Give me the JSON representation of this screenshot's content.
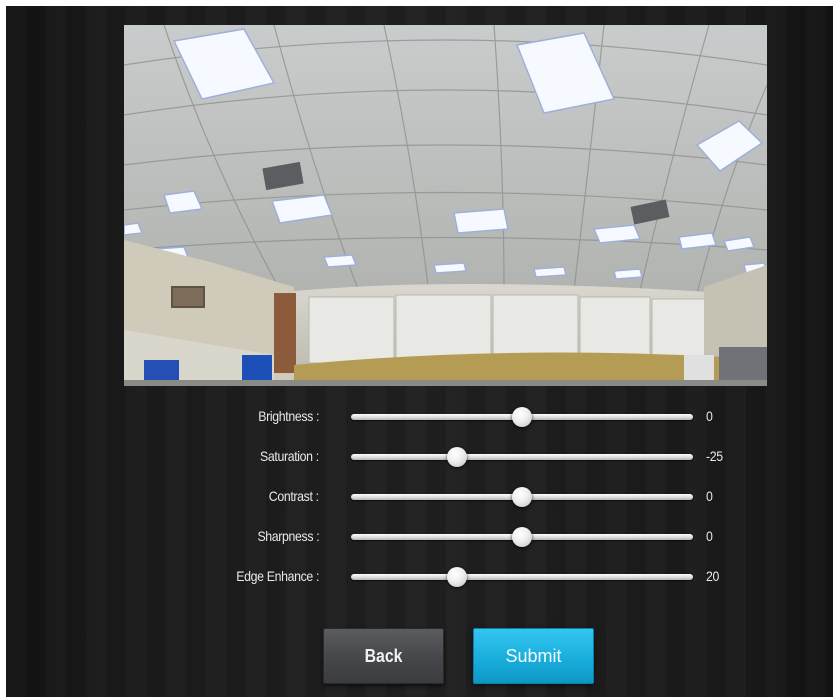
{
  "controls": [
    {
      "label": "Brightness :",
      "value": "0",
      "level": 0.5
    },
    {
      "label": "Saturation :",
      "value": "-25",
      "level": 0.31
    },
    {
      "label": "Contrast :",
      "value": "0",
      "level": 0.5
    },
    {
      "label": "Sharpness :",
      "value": "0",
      "level": 0.5
    },
    {
      "label": "Edge Enhance :",
      "value": "20",
      "level": 0.31
    }
  ],
  "buttons": {
    "back_label": "Back",
    "submit_label": "Submit"
  },
  "colors": {
    "accent": "#1aaedc",
    "background": "#1e1e1e"
  },
  "icons": {
    "slider_thumb": "slider-knob-icon"
  }
}
